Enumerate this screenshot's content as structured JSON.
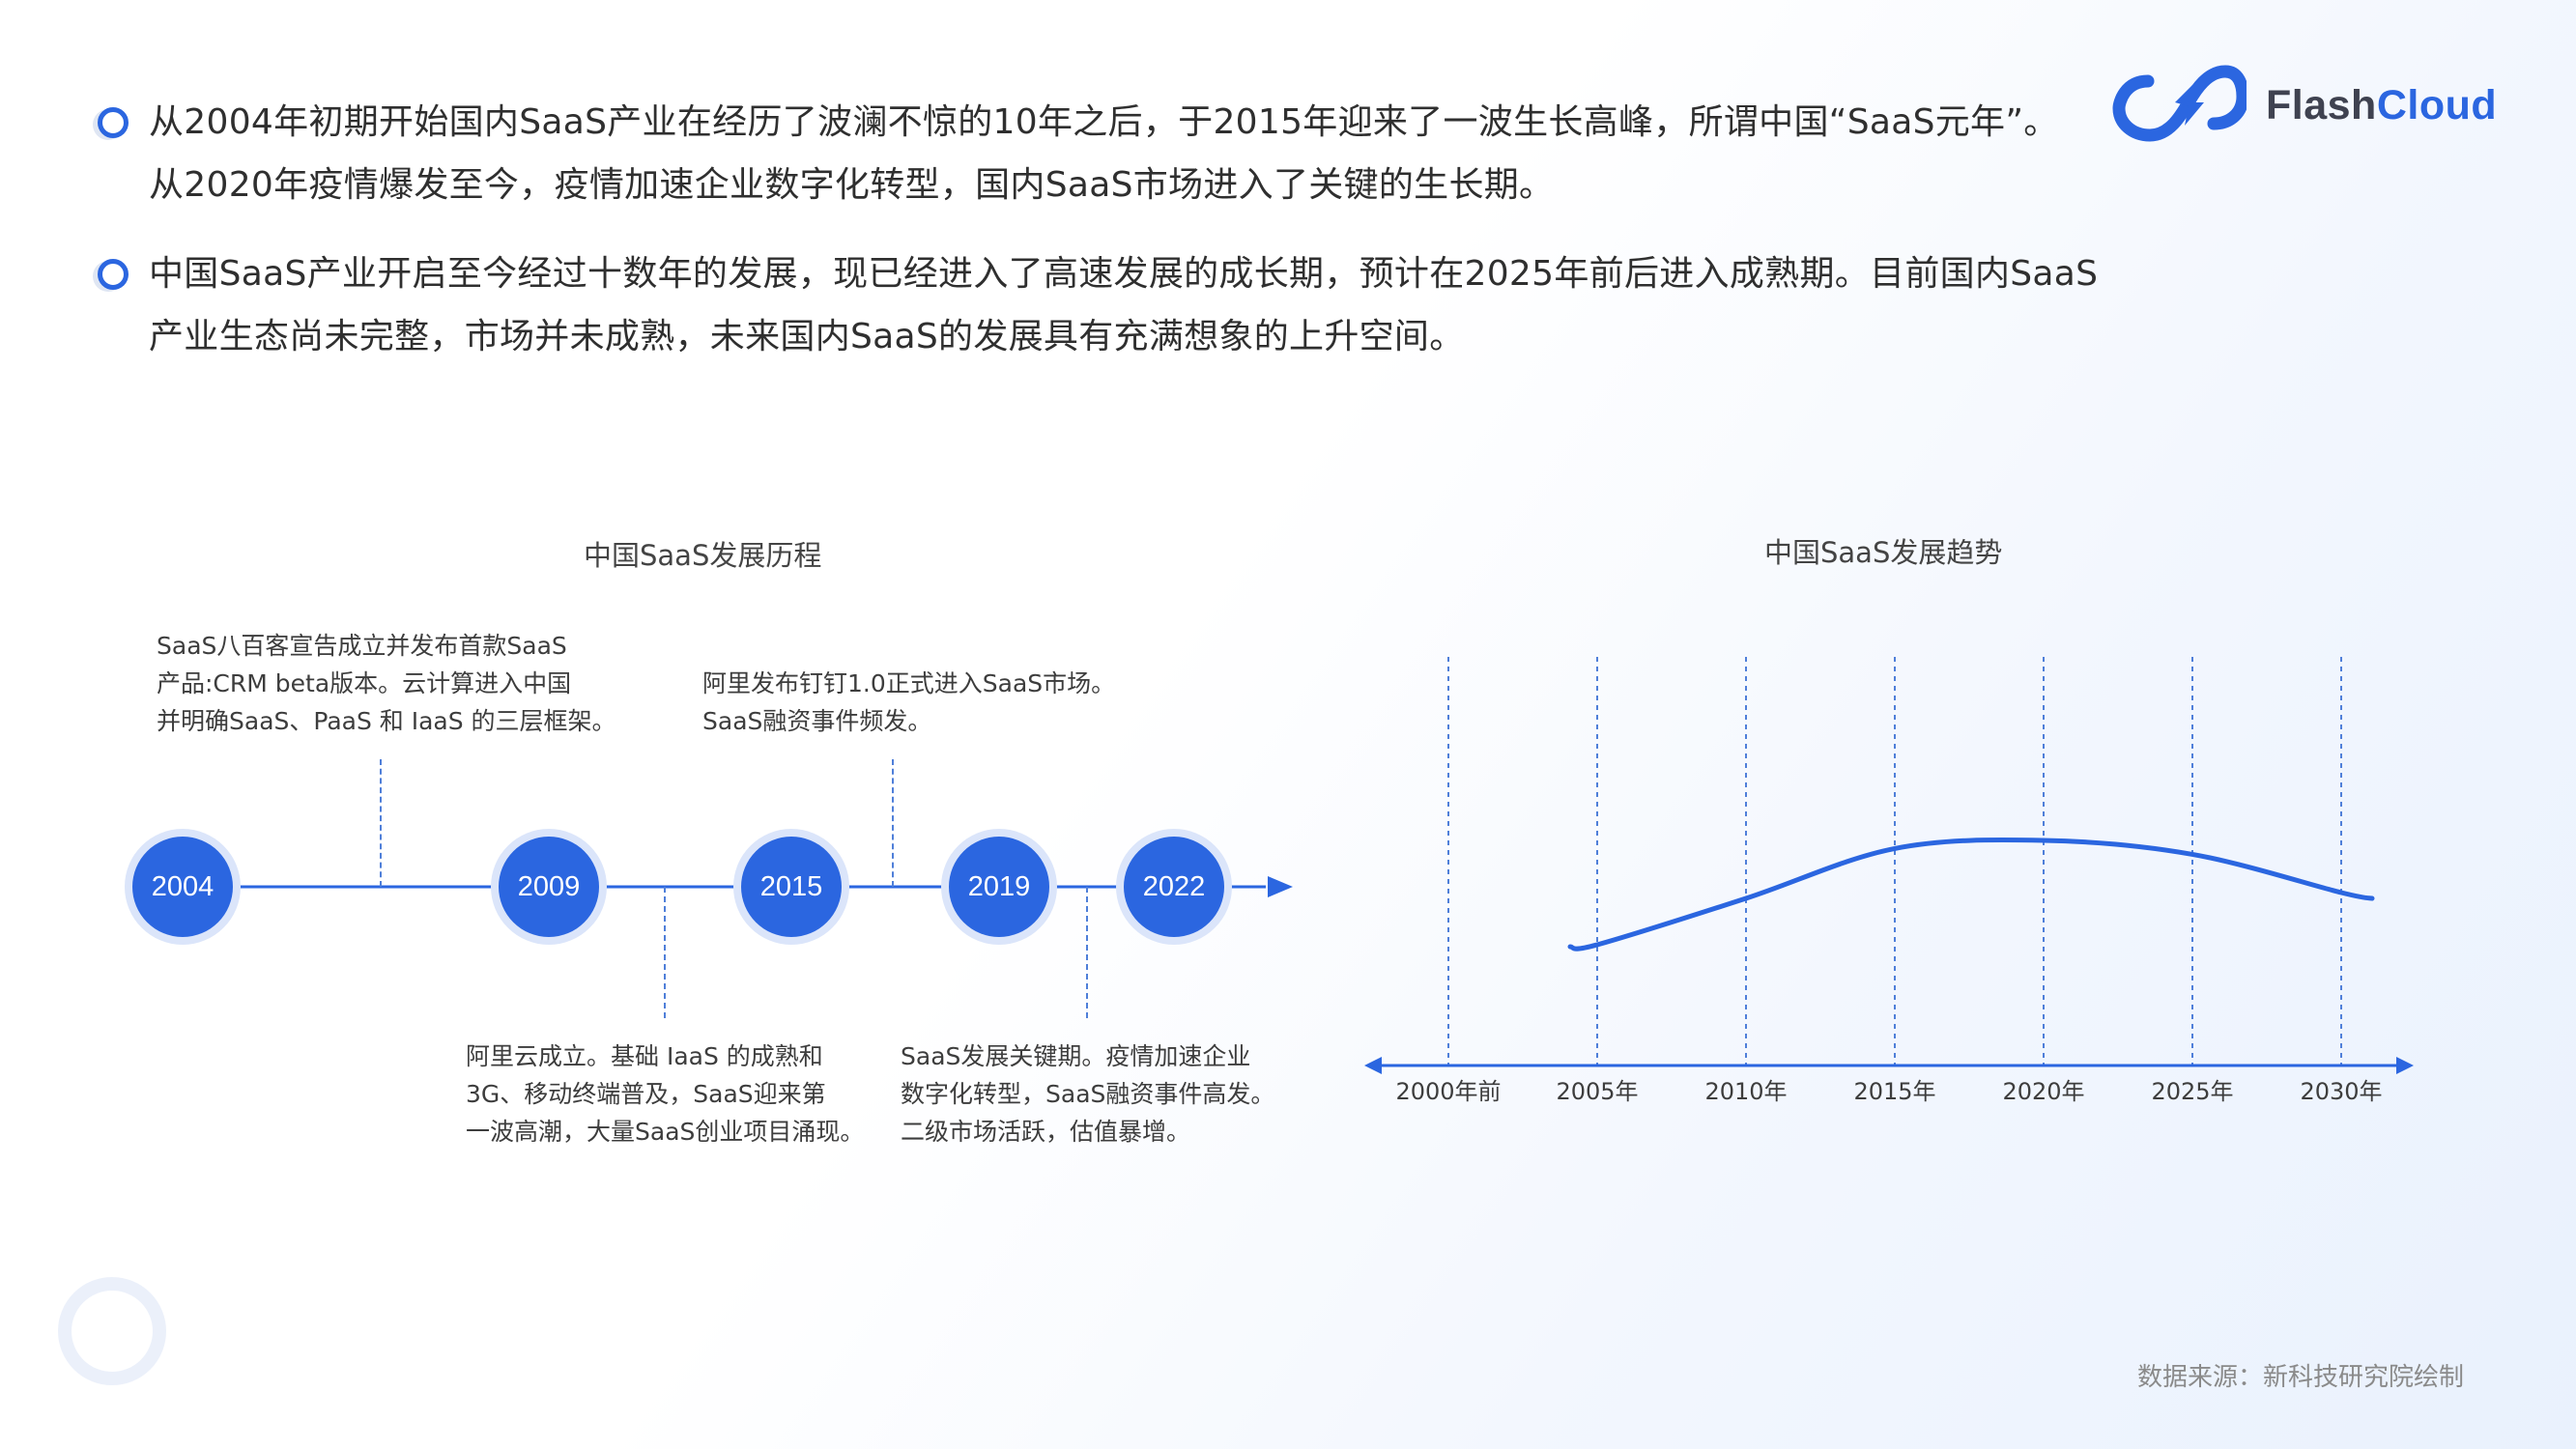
{
  "brand": {
    "name_part1": "Flash",
    "name_part2": "Cloud",
    "logo_icon": "infinity-lightning-icon",
    "accent_color": "#2b66e0"
  },
  "bullets": [
    {
      "line1": "从2004年初期开始国内SaaS产业在经历了波澜不惊的10年之后，于2015年迎来了一波生长高峰，所谓中国“SaaS元年”。",
      "line2": "从2020年疫情爆发至今，疫情加速企业数字化转型，国内SaaS市场进入了关键的生长期。"
    },
    {
      "line1": "中国SaaS产业开启至今经过十数年的发展，现已经进入了高速发展的成长期，预计在2025年前后进入成熟期。目前国内SaaS",
      "line2": "产业生态尚未完整，市场并未成熟，未来国内SaaS的发展具有充满想象的上升空间。"
    }
  ],
  "timeline": {
    "title": "中国SaaS发展历程",
    "years": [
      "2004",
      "2009",
      "2015",
      "2019",
      "2022"
    ],
    "notes": [
      [
        "SaaS八百客宣告成立并发布首款SaaS",
        "产品:CRM beta版本。云计算进入中国",
        "并明确SaaS、PaaS 和 IaaS 的三层框架。"
      ],
      [
        "阿里云成立。基础 IaaS 的成熟和",
        "3G、移动终端普及，SaaS迎来第",
        "一波高潮，大量SaaS创业项目涌现。"
      ],
      [
        "阿里发布钉钉1.0正式进入SaaS市场。",
        "SaaS融资事件频发。"
      ],
      [
        "SaaS发展关键期。疫情加速企业",
        "数字化转型，SaaS融资事件高发。",
        "二级市场活跃，估值暴增。"
      ]
    ]
  },
  "chart_data": {
    "type": "line",
    "title": "中国SaaS发展趋势",
    "categories": [
      "2000年前",
      "2005年",
      "2010年",
      "2015年",
      "2020年",
      "2025年",
      "2030年"
    ],
    "series": [
      {
        "x": [
          "2005年",
          "2010年",
          "2015年",
          "2020年",
          "2025年",
          "2030年"
        ],
        "values": [
          0.1,
          0.5,
          0.93,
          1.0,
          0.88,
          0.55
        ]
      }
    ],
    "grid": "vertical dashed lines at each category",
    "yaxis": "none (qualitative trend)",
    "line_color": "#2b66e0"
  },
  "source": "数据来源：新科技研究院绘制"
}
